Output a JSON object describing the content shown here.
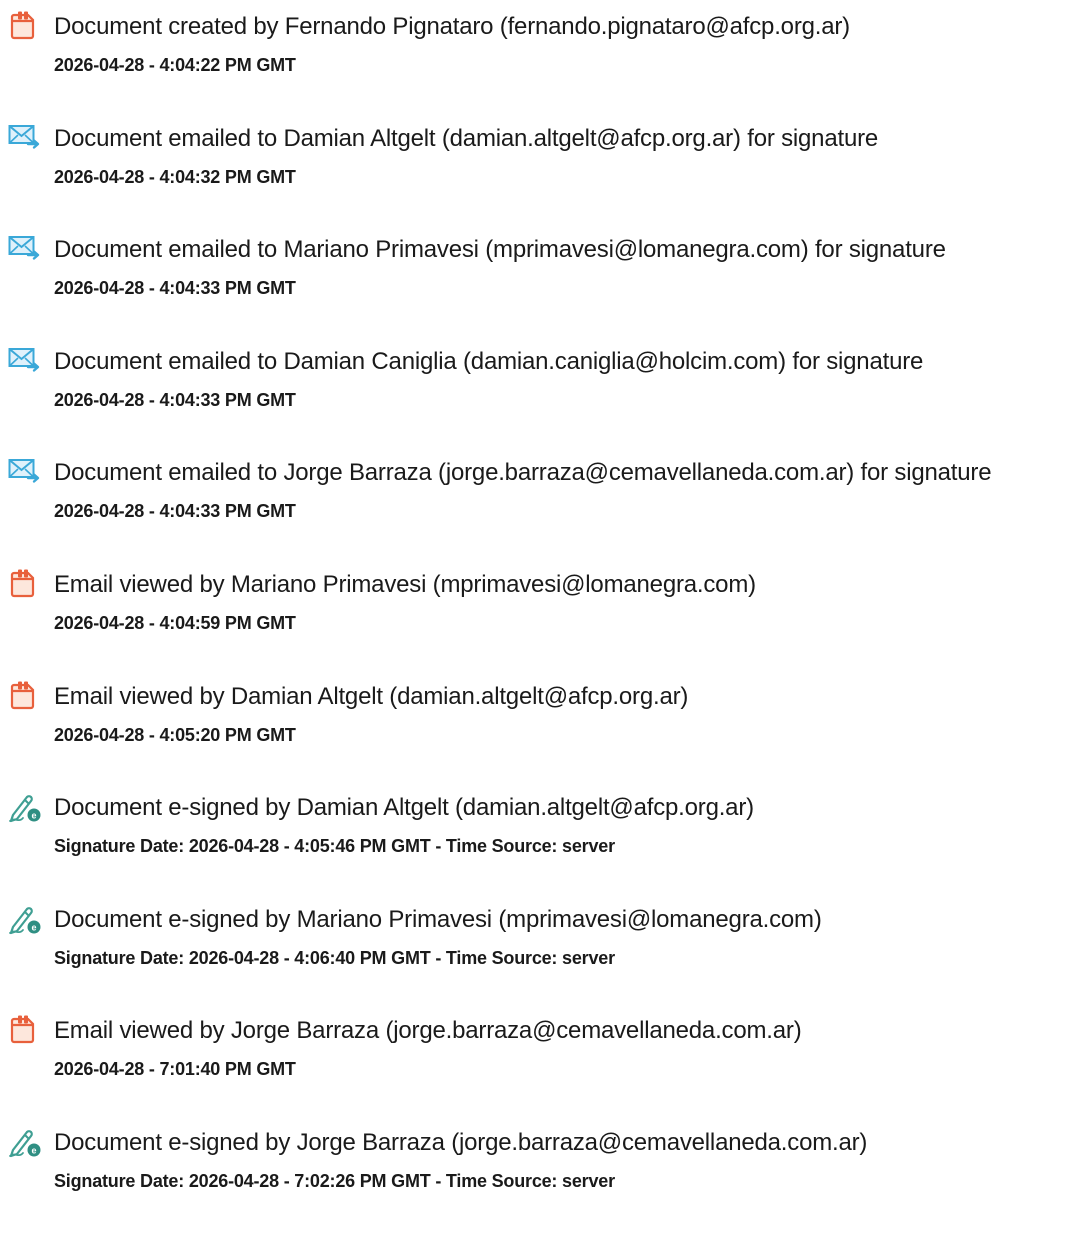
{
  "colors": {
    "created_icon": "#e8603c",
    "created_icon_fill": "#fde7dc",
    "email_icon": "#3aa8d8",
    "email_icon_fill": "#dff1fb",
    "sign_icon": "#3f9f93",
    "sign_badge": "#2f8f83"
  },
  "entries": [
    {
      "icon": "document-icon",
      "text": "Document created by Fernando Pignataro (fernando.pignataro@afcp.org.ar)",
      "stamp": "2026-04-28 - 4:04:22 PM GMT"
    },
    {
      "icon": "email-icon",
      "text": "Document emailed to Damian Altgelt (damian.altgelt@afcp.org.ar) for signature",
      "stamp": "2026-04-28 - 4:04:32 PM GMT"
    },
    {
      "icon": "email-icon",
      "text": "Document emailed to Mariano Primavesi (mprimavesi@lomanegra.com) for signature",
      "stamp": "2026-04-28 - 4:04:33 PM GMT"
    },
    {
      "icon": "email-icon",
      "text": "Document emailed to Damian Caniglia (damian.caniglia@holcim.com) for signature",
      "stamp": "2026-04-28 - 4:04:33 PM GMT"
    },
    {
      "icon": "email-icon",
      "text": "Document emailed to Jorge Barraza (jorge.barraza@cemavellaneda.com.ar) for signature",
      "stamp": "2026-04-28 - 4:04:33 PM GMT"
    },
    {
      "icon": "document-icon",
      "text": "Email viewed by Mariano Primavesi (mprimavesi@lomanegra.com)",
      "stamp": "2026-04-28 - 4:04:59 PM GMT"
    },
    {
      "icon": "document-icon",
      "text": "Email viewed by Damian Altgelt (damian.altgelt@afcp.org.ar)",
      "stamp": "2026-04-28 - 4:05:20 PM GMT"
    },
    {
      "icon": "esign-icon",
      "text": "Document e-signed by Damian Altgelt (damian.altgelt@afcp.org.ar)",
      "stamp": "Signature Date: 2026-04-28 - 4:05:46 PM GMT - Time Source: server"
    },
    {
      "icon": "esign-icon",
      "text": "Document e-signed by Mariano Primavesi (mprimavesi@lomanegra.com)",
      "stamp": "Signature Date: 2026-04-28 - 4:06:40 PM GMT - Time Source: server"
    },
    {
      "icon": "document-icon",
      "text": "Email viewed by Jorge Barraza (jorge.barraza@cemavellaneda.com.ar)",
      "stamp": "2026-04-28 - 7:01:40 PM GMT"
    },
    {
      "icon": "esign-icon",
      "text": "Document e-signed by Jorge Barraza (jorge.barraza@cemavellaneda.com.ar)",
      "stamp": "Signature Date: 2026-04-28 - 7:02:26 PM GMT - Time Source: server"
    }
  ]
}
